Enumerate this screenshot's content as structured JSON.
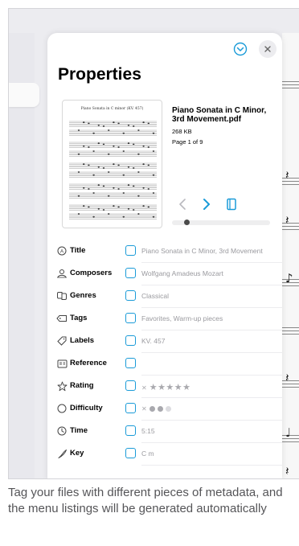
{
  "panel": {
    "title": "Properties",
    "thumbnail_title": "Piano Sonata in C minor (KV. 457)",
    "file": {
      "name": "Piano Sonata in C Minor, 3rd Movement.pdf",
      "size": "268 KB",
      "page_info": "Page 1 of 9"
    },
    "page_progress": 0.15
  },
  "rows": [
    {
      "label": "Title",
      "icon": "title-icon",
      "value": "Piano Sonata in C Minor, 3rd Movement"
    },
    {
      "label": "Composers",
      "icon": "composer-icon",
      "value": "Wolfgang Amadeus Mozart"
    },
    {
      "label": "Genres",
      "icon": "genres-icon",
      "value": "Classical"
    },
    {
      "label": "Tags",
      "icon": "tag-icon",
      "value": "Favorites, Warm-up pieces"
    },
    {
      "label": "Labels",
      "icon": "label-icon",
      "value": "KV. 457"
    },
    {
      "label": "Reference",
      "icon": "reference-icon",
      "value": ""
    },
    {
      "label": "Rating",
      "icon": "star-icon",
      "value": "★★★★★"
    },
    {
      "label": "Difficulty",
      "icon": "difficulty-icon",
      "value": ""
    },
    {
      "label": "Time",
      "icon": "time-icon",
      "value": "5:15"
    },
    {
      "label": "Key",
      "icon": "key-icon",
      "value": "C m"
    }
  ],
  "rating": {
    "stars_filled": 0,
    "stars_total": 5
  },
  "difficulty": {
    "level": 2,
    "max": 3
  },
  "colors": {
    "accent": "#1a9bd8",
    "muted": "#a9a9ae"
  },
  "caption": "Tag your files with different pieces of metadata, and the menu listings will be generated automatically"
}
